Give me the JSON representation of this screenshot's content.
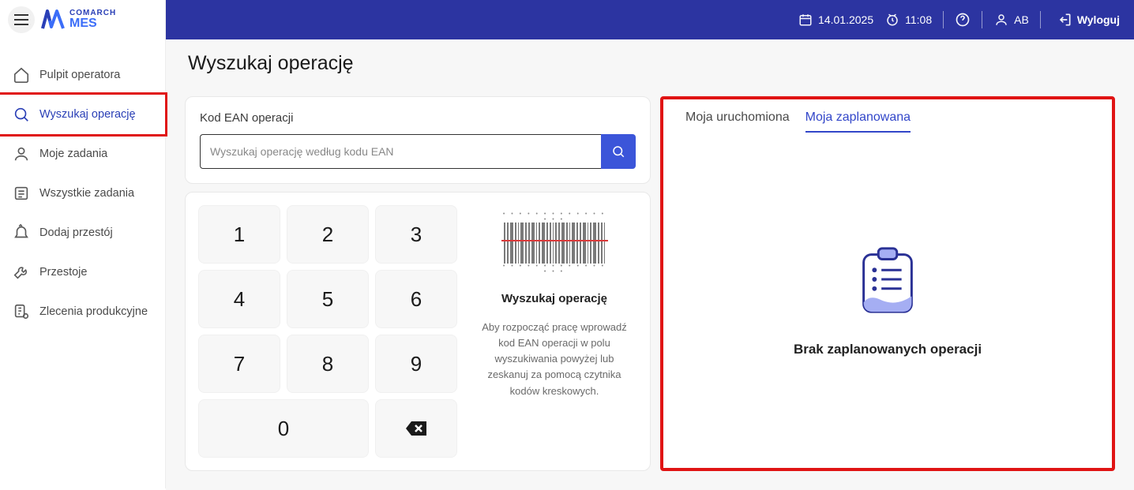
{
  "header": {
    "brand_top": "COMARCH",
    "brand_bottom": "MES",
    "date": "14.01.2025",
    "time": "11:08",
    "user": "AB",
    "logout": "Wyloguj"
  },
  "sidebar": {
    "items": [
      {
        "label": "Pulpit operatora",
        "icon": "home"
      },
      {
        "label": "Wyszukaj operację",
        "icon": "search",
        "highlighted": true
      },
      {
        "label": "Moje zadania",
        "icon": "user"
      },
      {
        "label": "Wszystkie zadania",
        "icon": "list"
      },
      {
        "label": "Dodaj przestój",
        "icon": "bell"
      },
      {
        "label": "Przestoje",
        "icon": "wrench"
      },
      {
        "label": "Zlecenia produkcyjne",
        "icon": "orders"
      }
    ]
  },
  "page": {
    "title": "Wyszukaj operację",
    "search": {
      "label": "Kod EAN operacji",
      "placeholder": "Wyszukaj operację według kodu EAN"
    },
    "keypad": [
      "1",
      "2",
      "3",
      "4",
      "5",
      "6",
      "7",
      "8",
      "9",
      "0"
    ],
    "scan": {
      "title": "Wyszukaj operację",
      "description": "Aby rozpocząć pracę wprowadź kod EAN operacji w polu wyszukiwania powyżej lub zeskanuj za pomocą czytnika kodów kreskowych."
    },
    "panel": {
      "tabs": [
        "Moja uruchomiona",
        "Moja zaplanowana"
      ],
      "active_tab": 1,
      "empty_message": "Brak zaplanowanych operacji"
    }
  }
}
